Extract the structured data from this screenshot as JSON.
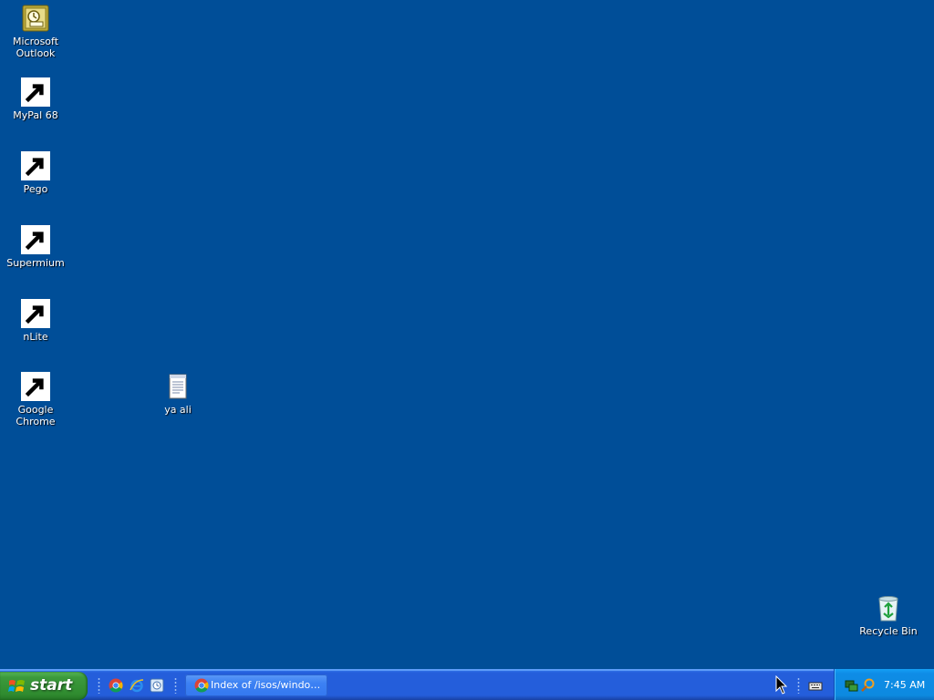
{
  "desktop": {
    "background_color": "#004e98",
    "icons": [
      {
        "label_line1": "Microsoft",
        "label_line2": "Outlook",
        "icon": "outlook-icon"
      },
      {
        "label": "MyPal 68",
        "icon": "mypal-raccoon-icon"
      },
      {
        "label": "Pego",
        "icon": "pego-icon"
      },
      {
        "label": "Supermium",
        "icon": "supermium-icon"
      },
      {
        "label": "nLite",
        "icon": "nlite-gear-icon"
      },
      {
        "label": "Google Chrome",
        "icon": "chrome-icon"
      },
      {
        "label": "ya ali",
        "icon": "text-document-icon"
      },
      {
        "label": "Recycle Bin",
        "icon": "recycle-bin-icon"
      }
    ]
  },
  "taskbar": {
    "start_label": "start",
    "quick_launch": [
      "chrome-icon",
      "internet-explorer-icon",
      "outlook-icon"
    ],
    "open_windows": [
      {
        "label": "Index of /isos/windo…",
        "icon": "chrome-icon"
      }
    ],
    "tray": {
      "icons": [
        "keyboard-icon",
        "network-icon",
        "search-icon"
      ],
      "clock": "7:45 AM"
    }
  }
}
